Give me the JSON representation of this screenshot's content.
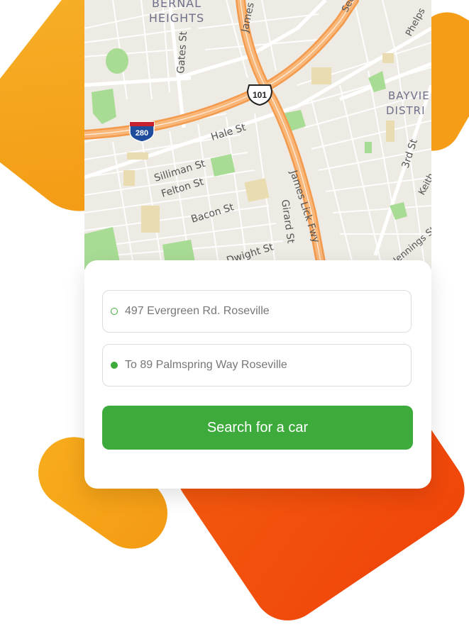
{
  "map": {
    "labels": {
      "bernal": "BERNAL",
      "heights": "HEIGHTS",
      "gates": "Gates St",
      "james_top": "James",
      "sec": "Sec",
      "phelps": "Phelps",
      "bayview": "BAYVIE",
      "district": "DISTRI",
      "hale": "Hale St",
      "silliman": "Silliman St",
      "felton": "Felton St",
      "bacon": "Bacon St",
      "dwight": "Dwight St",
      "girard": "Girard St",
      "james_lick": "James Lick Fwy",
      "third": "3rd St",
      "keith": "Keith",
      "jennings": "Jennings St"
    },
    "shields": {
      "us101": "101",
      "i280": "280"
    },
    "colors": {
      "land": "#eeebe4",
      "freeway": "#f7a257",
      "park": "#a8dc95",
      "sand": "#e8dcb0"
    }
  },
  "form": {
    "from_text": "497 Evergreen Rd. Roseville",
    "to_text": "To 89 Palmspring Way Roseville",
    "search_label": "Search for a car",
    "accent_color": "#3dab3b"
  }
}
